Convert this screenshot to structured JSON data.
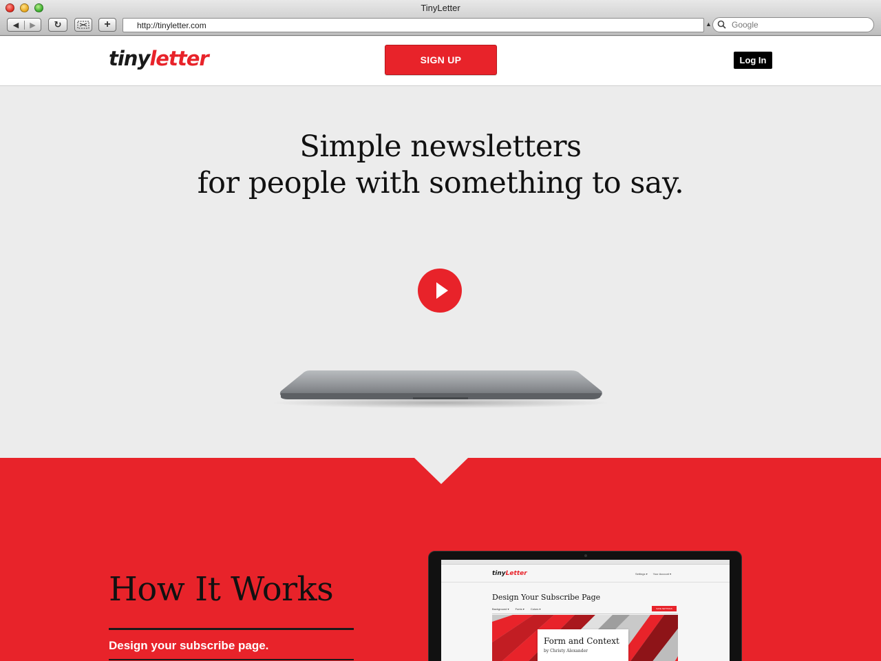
{
  "browser": {
    "window_title": "TinyLetter",
    "url": "http://tinyletter.com",
    "search_placeholder": "Google",
    "buttons": {
      "back": "◀",
      "forward": "▶",
      "reload": "↻",
      "add_tab": "+"
    }
  },
  "header": {
    "logo_part1": "tiny",
    "logo_part2": "letter",
    "signup_label": "SIGN UP",
    "login_label": "Log In"
  },
  "hero": {
    "headline_line1": "Simple newsletters",
    "headline_line2": "for people with something to say."
  },
  "how": {
    "title": "How It Works",
    "step1": "Design your subscribe page."
  },
  "mockup": {
    "logo_part1": "tiny",
    "logo_part2": "Letter",
    "nav": [
      "Settings ▾",
      "Your Account ▾"
    ],
    "page_title": "Design Your Subscribe Page",
    "tabs": [
      "Background ▾",
      "Fonts ▾",
      "Colors ▾"
    ],
    "save_label": "SAVE SETTINGS",
    "card_title": "Form and Context",
    "card_byline": "by Christy Alexander"
  },
  "colors": {
    "brand_red": "#e8232a",
    "hero_bg": "#ececec",
    "dark": "#111111"
  }
}
